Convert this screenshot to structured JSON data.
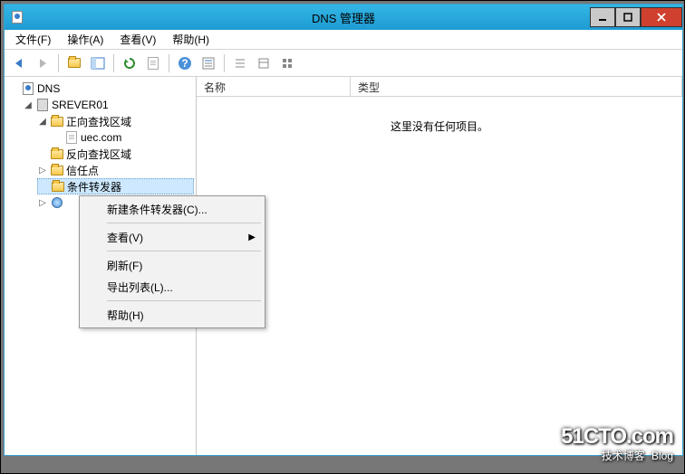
{
  "window": {
    "title": "DNS 管理器"
  },
  "menubar": [
    "文件(F)",
    "操作(A)",
    "查看(V)",
    "帮助(H)"
  ],
  "tree": {
    "root": "DNS",
    "server": "SREVER01",
    "fwd": "正向查找区域",
    "zone": "uec.com",
    "rev": "反向查找区域",
    "trust": "信任点",
    "cond": "条件转发器"
  },
  "columns": {
    "name": "名称",
    "type": "类型"
  },
  "empty": "这里没有任何项目。",
  "context": {
    "new": "新建条件转发器(C)...",
    "view": "查看(V)",
    "refresh": "刷新(F)",
    "export": "导出列表(L)...",
    "help": "帮助(H)"
  },
  "watermark": {
    "main": "51CTO.com",
    "sub": "技术博客",
    "tag": "Blog"
  }
}
